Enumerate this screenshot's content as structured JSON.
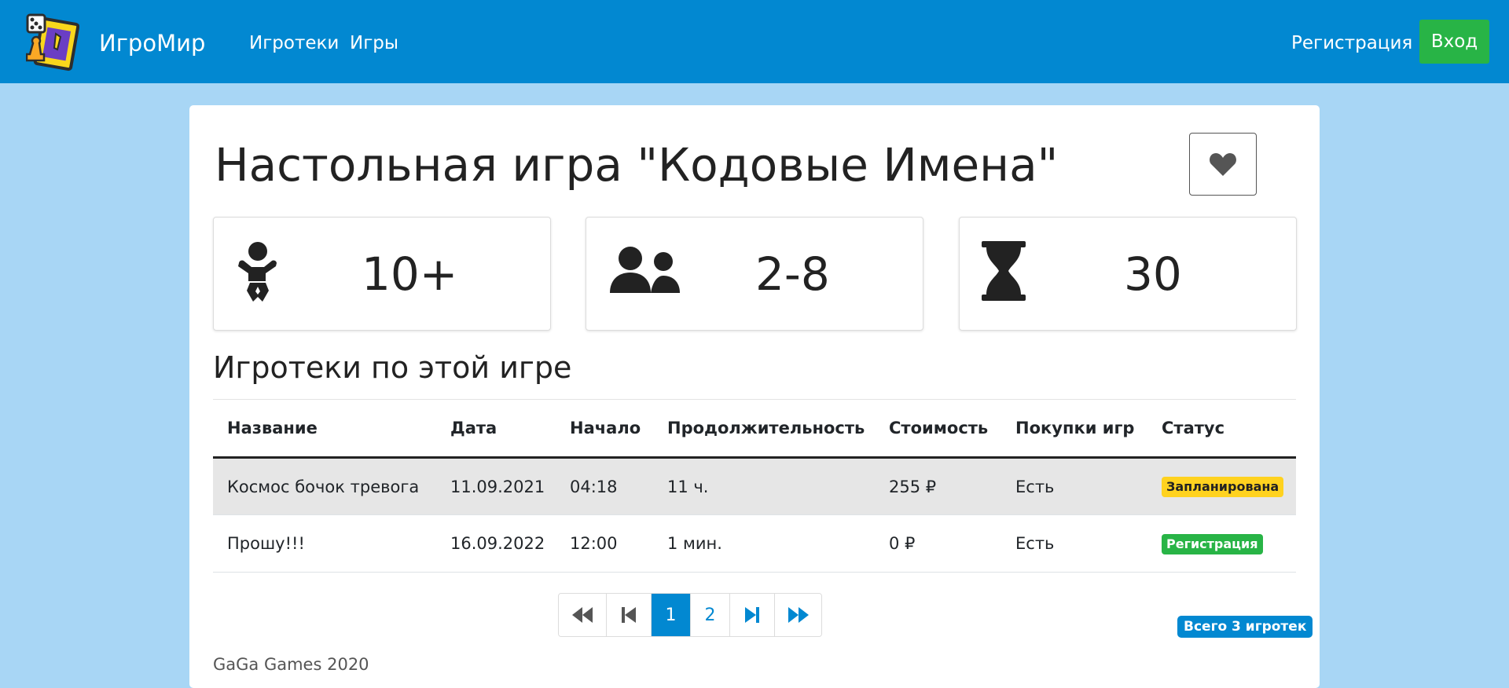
{
  "navbar": {
    "brand": "ИгроМир",
    "links": [
      "Игротеки",
      "Игры"
    ],
    "register": "Регистрация",
    "login": "Вход"
  },
  "game": {
    "title": "Настольная игра \"Кодовые Имена\"",
    "stats": {
      "age": "10+",
      "players": "2-8",
      "duration": "30"
    }
  },
  "sessions": {
    "title": "Игротеки по этой игре",
    "columns": [
      "Название",
      "Дата",
      "Начало",
      "Продолжительность",
      "Стоимость",
      "Покупки игр",
      "Статус"
    ],
    "rows": [
      {
        "name": "Космос бочок тревога",
        "date": "11.09.2021",
        "start": "04:18",
        "duration": "11 ч.",
        "price": "255 ₽",
        "purchases": "Есть",
        "status": "Запланирована"
      },
      {
        "name": "Прошу!!!",
        "date": "16.09.2022",
        "start": "12:00",
        "duration": "1 мин.",
        "price": "0 ₽",
        "purchases": "Есть",
        "status": "Регистрация"
      }
    ]
  },
  "pagination": {
    "pages": [
      "1",
      "2"
    ],
    "active": "1"
  },
  "total": "Всего 3 игротек",
  "footer": "GaGa Games 2020",
  "colors": {
    "navbar": "#0288d1",
    "background": "#a8d6f5",
    "login_button": "#28b446",
    "badge_planned": "#ffd21f",
    "badge_registration": "#28b446"
  }
}
